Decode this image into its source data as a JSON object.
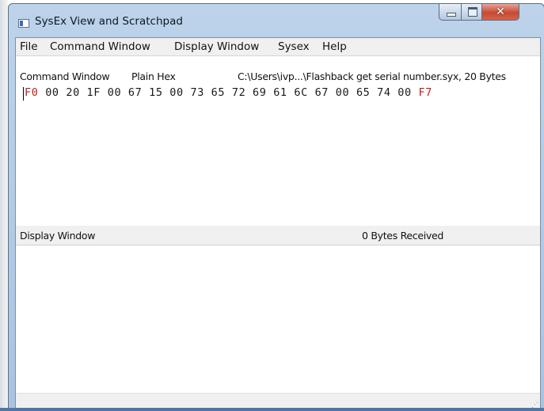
{
  "window": {
    "title": "SysEx View and Scratchpad"
  },
  "menu": [
    "File",
    "Command Window",
    "Display Window",
    "Sysex",
    "Help"
  ],
  "command_window": {
    "label": "Command Window",
    "mode": "Plain Hex",
    "file_info": "C:\\Users\\ivp...\\Flashback get serial number.syx,  20 Bytes",
    "hex_start": "F0",
    "hex_body": " 00 20 1F 00 67 15 00 73 65 72 69 61 6C 67 00 65 74 00 ",
    "hex_end": "F7"
  },
  "display_window": {
    "label": "Display Window",
    "bytes_received": "0  Bytes Received"
  },
  "colors": {
    "sysex_marker": "#c11f1f",
    "titlebar": "#bcd3ea",
    "close_button": "#c74a32"
  },
  "icons": [
    "app-icon",
    "minimize-icon",
    "maximize-icon",
    "close-icon",
    "resize-grip-icon"
  ]
}
